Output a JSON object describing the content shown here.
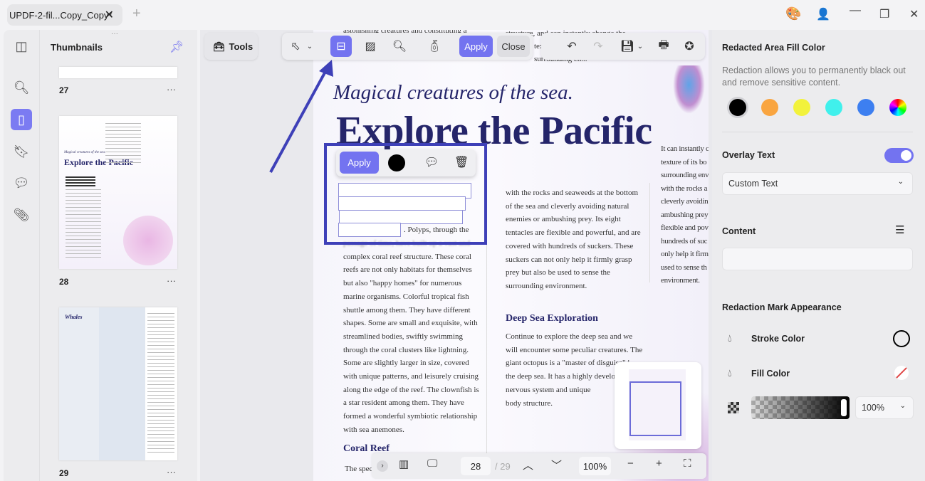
{
  "titlebar": {
    "tab_title": "UPDF-2-fil...Copy_Copy*",
    "close": "✕",
    "new_tab": "+",
    "window_controls": [
      "minimize",
      "maximize",
      "close"
    ]
  },
  "rail": {
    "items": [
      "thumbnails-grid-icon",
      "search-icon",
      "pages-icon",
      "bookmark-icon",
      "comment-icon",
      "attachment-icon"
    ]
  },
  "thumbnails": {
    "title": "Thumbnails",
    "pages": [
      {
        "number": "27",
        "more": "···"
      },
      {
        "number": "28",
        "more": "···",
        "title": "Explore the Pacific",
        "subtitle": "Magical creatures of the sea."
      },
      {
        "number": "29",
        "more": "···",
        "title": "Whales"
      }
    ]
  },
  "toolbar": {
    "tools_label": "Tools",
    "apply_label": "Apply",
    "close_label": "Close"
  },
  "redact_popup": {
    "apply_label": "Apply",
    "fill_color": "#000000"
  },
  "document": {
    "top_line_left": "astonishing creatures and constituting a",
    "top_line_right": [
      "structure, and can instantly change the",
      "texture ...",
      "surrounding en..."
    ],
    "subtitle": "Magical creatures of the sea.",
    "title": "Explore the Pacific",
    "col1_after_redact": ". Polyps, through the",
    "col1": [
      "passage of time, have built up a vast and",
      "complex coral reef structure. These coral",
      "reefs are not only habitats for themselves",
      "but also \"happy homes\" for numerous",
      "marine organisms. Colorful tropical fish",
      "shuttle among them. They have different",
      "shapes. Some are small and exquisite, with",
      "streamlined bodies, swiftly swimming",
      "through the coral clusters like lightning.",
      "Some are slightly larger in size, covered",
      "with unique patterns, and leisurely cruising",
      "along the edge of the reef. The clownfish is",
      "a star resident among them. They have",
      "formed a wonderful symbiotic relationship",
      "with sea anemones."
    ],
    "coral_heading": "Coral Reef",
    "coral_start": "The spec",
    "col2": [
      "with the rocks and seaweeds at the bottom",
      "of the sea and cleverly avoiding natural",
      "enemies or ambushing prey. Its eight",
      "tentacles are flexible and powerful, and are",
      "covered with hundreds of suckers. These",
      "suckers can not only help it firmly grasp",
      "prey but also be used to sense the",
      "surrounding environment."
    ],
    "deep_heading": "Deep Sea Exploration",
    "col2b": [
      "Continue to explore the deep sea and we",
      "will encounter some peculiar creatures. The",
      "giant octopus is a \"master of disguise\" i",
      "the deep sea. It has a highly develope",
      "nervous system and unique",
      "body structure."
    ],
    "col3": [
      "It can instantly c",
      "texture of its bo",
      "surrounding env",
      "with the rocks a",
      "cleverly avoidin",
      "ambushing prey",
      "flexible and pov",
      "hundreds of suc",
      "only help it firm",
      "used to sense th",
      "environment."
    ]
  },
  "bottom_bar": {
    "current_page": "28",
    "total_pages": "/ 29",
    "zoom": "100%"
  },
  "right_panel": {
    "fill_title": "Redacted Area Fill Color",
    "fill_desc": "Redaction allows you to permanently black out and remove sensitive content.",
    "swatches": [
      "#000000",
      "#f9a540",
      "#f2f23c",
      "#40f0ec",
      "#3d7ff0",
      "rainbow"
    ],
    "selected_swatch": "#000000",
    "overlay_label": "Overlay Text",
    "overlay_on": true,
    "overlay_select": "Custom Text",
    "content_label": "Content",
    "content_value": "",
    "appearance_title": "Redaction Mark Appearance",
    "stroke_label": "Stroke Color",
    "stroke_color": "#000000",
    "fill_label": "Fill Color",
    "fill_color": "none",
    "opacity": "100%",
    "accent": "#7373f0"
  }
}
